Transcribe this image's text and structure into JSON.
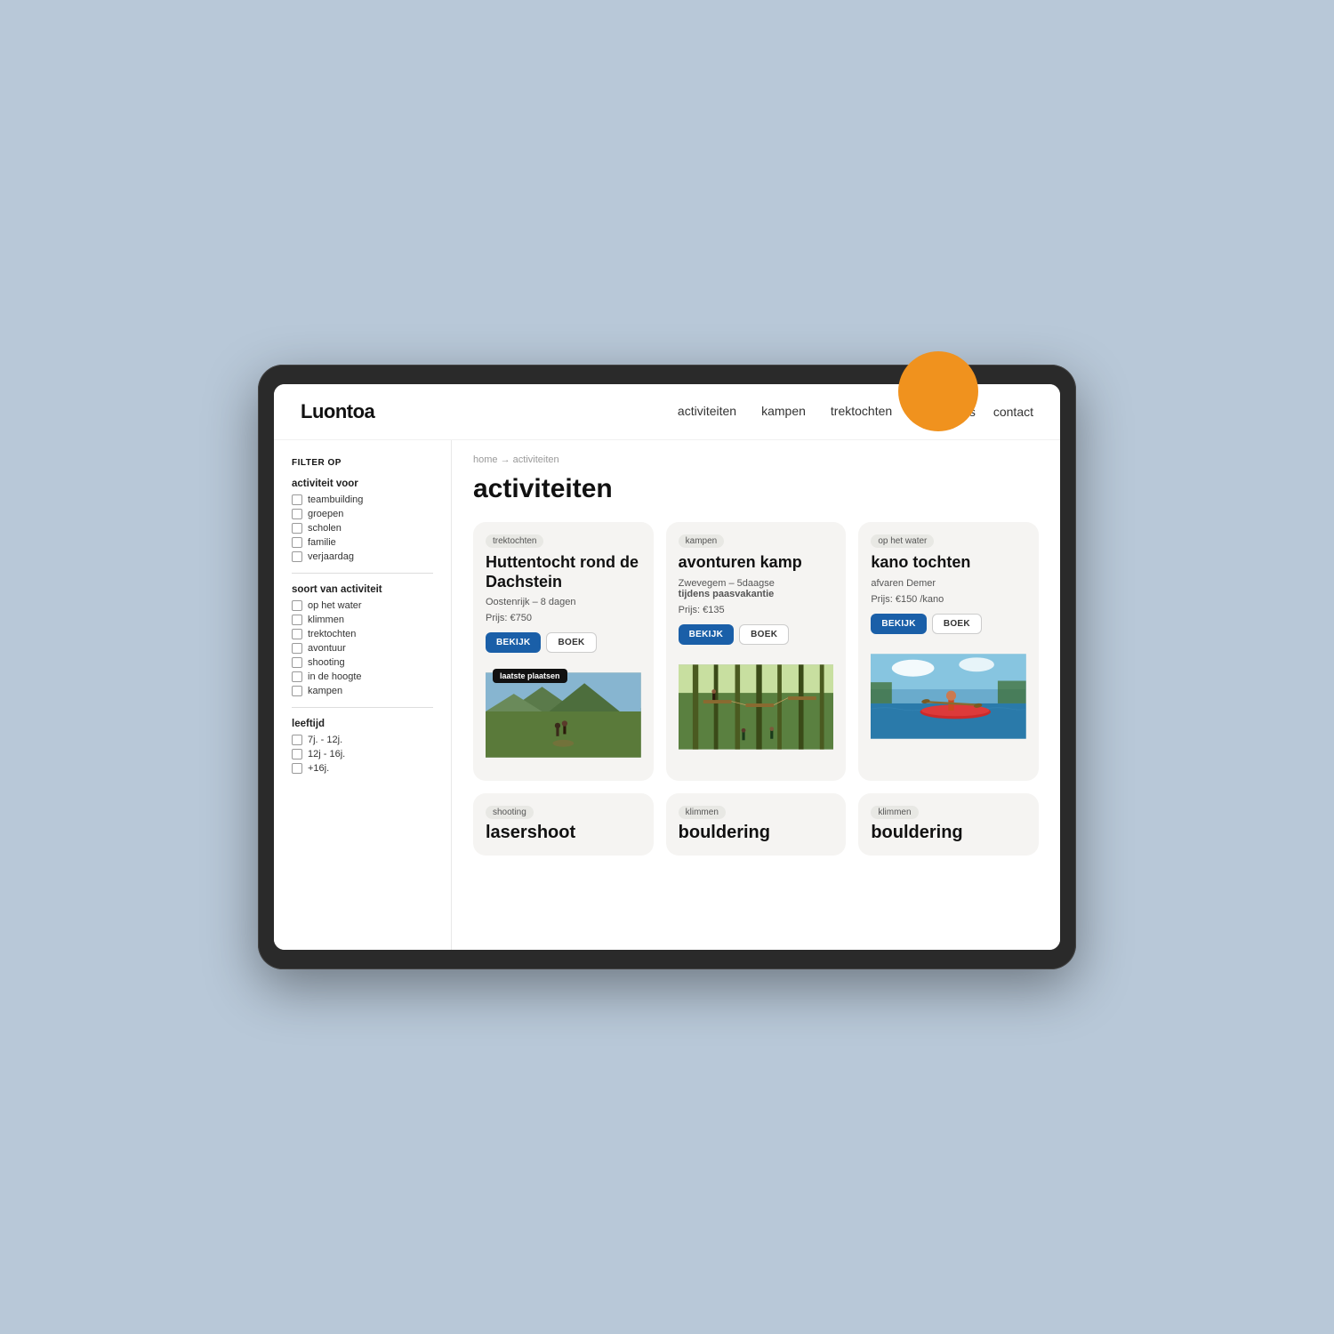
{
  "background_color": "#b8c8d8",
  "nav": {
    "logo": "Luontoa",
    "links": [
      "activiteiten",
      "kampen",
      "trektochten"
    ],
    "right_links": [
      "over ons",
      "contact"
    ]
  },
  "breadcrumb": {
    "home": "home",
    "separator": "→",
    "current": "activiteiten"
  },
  "page_title": "activiteiten",
  "sidebar": {
    "filter_heading": "FILTER OP",
    "activiteit_voor_label": "activiteit voor",
    "activiteit_voor_items": [
      "teambuilding",
      "groepen",
      "scholen",
      "familie",
      "verjaardag"
    ],
    "soort_label": "soort van activiteit",
    "soort_items": [
      "op het water",
      "klimmen",
      "trektochten",
      "avontuur",
      "shooting",
      "in de hoogte",
      "kampen"
    ],
    "leeftijd_label": "leeftijd",
    "leeftijd_items": [
      "7j. - 12j.",
      "12j - 16j.",
      "+16j."
    ]
  },
  "cards": [
    {
      "id": "card1",
      "category": "trektochten",
      "title": "Huttentocht rond de Dachstein",
      "subtitle": "Oostenrijk – 8 dagen",
      "price": "Prijs: €750",
      "bekijk_label": "BEKIJK",
      "boek_label": "BOEK",
      "badge": "laatste plaatsen",
      "image_type": "hiking"
    },
    {
      "id": "card2",
      "category": "kampen",
      "title": "avonturen kamp",
      "subtitle": "Zwevegem – 5daagse tijdens paasvakantie",
      "price": "Prijs: €135",
      "bekijk_label": "BEKIJK",
      "boek_label": "BOEK",
      "badge": null,
      "image_type": "forest"
    },
    {
      "id": "card3",
      "category": "op het water",
      "title": "kano tochten",
      "subtitle": "afvaren Demer",
      "price": "Prijs: €150 /kano",
      "bekijk_label": "BEKIJK",
      "boek_label": "BOEK",
      "badge": null,
      "image_type": "kayak"
    }
  ],
  "bottom_cards": [
    {
      "id": "bcard1",
      "category": "shooting",
      "title": "lasershoot"
    },
    {
      "id": "bcard2",
      "category": "klimmen",
      "title": "bouldering"
    },
    {
      "id": "bcard3",
      "category": "klimmen",
      "title": "bouldering"
    }
  ]
}
